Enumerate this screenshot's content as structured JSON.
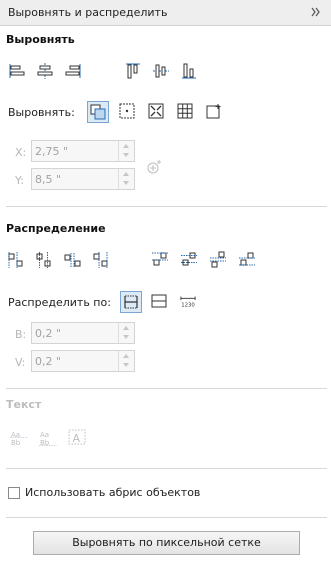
{
  "panel": {
    "title": "Выровнять и распределить",
    "menu_icon": "double-chevron-right-icon"
  },
  "align": {
    "section_title": "Выровнять",
    "row_icons": [
      "align-left-icon",
      "align-center-horizontal-icon",
      "align-right-icon",
      "align-top-icon",
      "align-center-vertical-icon",
      "align-bottom-icon"
    ],
    "target_label": "Выровнять:",
    "target_icons": [
      "active-objects-icon",
      "page-edge-icon",
      "page-center-icon",
      "grid-icon",
      "specified-point-icon"
    ],
    "x_label": "X:",
    "x_value": "2,75 \"",
    "y_label": "Y:",
    "y_value": "8,5 \"",
    "pick_point_icon": "crosshair-plus-icon"
  },
  "distribute": {
    "section_title": "Распределение",
    "row_icons": [
      "distribute-left-icon",
      "distribute-center-icon",
      "distribute-spacing-horizontal-icon",
      "distribute-right-icon",
      "distribute-top-icon",
      "distribute-center-vertical-icon",
      "distribute-spacing-vertical-icon",
      "distribute-bottom-icon"
    ],
    "by_label": "Распределить по:",
    "by_icons": [
      "selection-extent-icon",
      "page-extent-icon",
      "spacing-1230-icon"
    ],
    "b_label": "В:",
    "b_value": "0,2 \"",
    "v_label": "V:",
    "v_value": "0,2 \""
  },
  "text": {
    "section_title": "Текст",
    "icons": [
      "text-first-baseline-icon",
      "text-last-baseline-icon",
      "text-bounding-box-icon"
    ]
  },
  "use_outline": {
    "label": "Использовать абрис объектов",
    "checked": false
  },
  "pixel_grid_button": {
    "label": "Выровнять по пиксельной сетке"
  },
  "colors": {
    "active": "#dceaf6",
    "active_border": "#79a6d2",
    "icon_blue": "#2a6bb0"
  }
}
